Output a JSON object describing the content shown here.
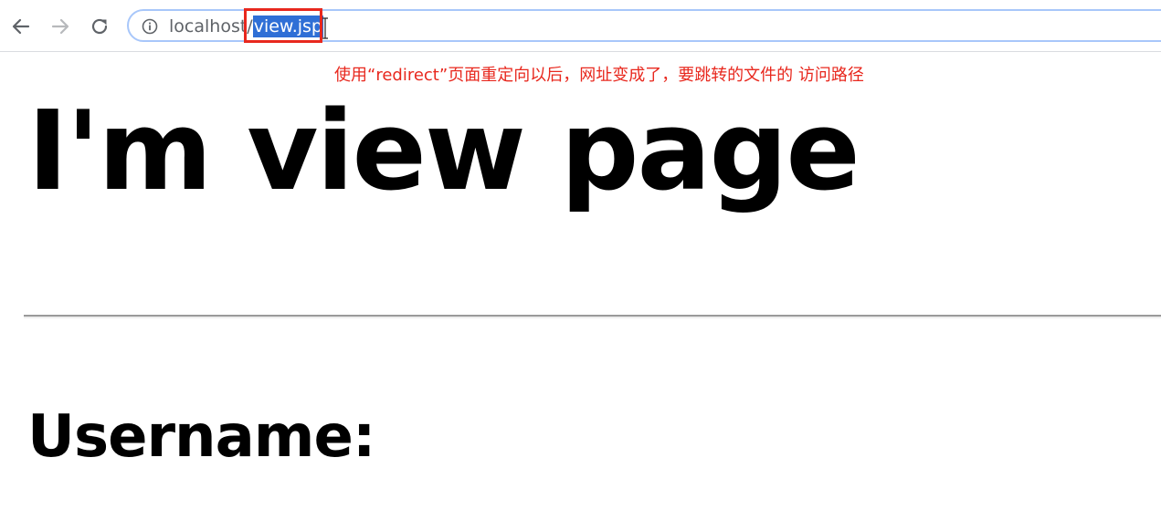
{
  "browser": {
    "back_icon": "arrow-left-icon",
    "forward_icon": "arrow-right-icon",
    "reload_icon": "reload-icon",
    "info_icon": "info-icon",
    "address": {
      "host": "localhost",
      "separator": "/",
      "path_selected": "view.jsp"
    }
  },
  "annotation": {
    "text": "使用“redirect”页面重定向以后，网址变成了，要跳转的文件的 访问路径",
    "color": "#e8281e"
  },
  "page": {
    "heading": "I'm view page",
    "username_label": "Username:"
  }
}
